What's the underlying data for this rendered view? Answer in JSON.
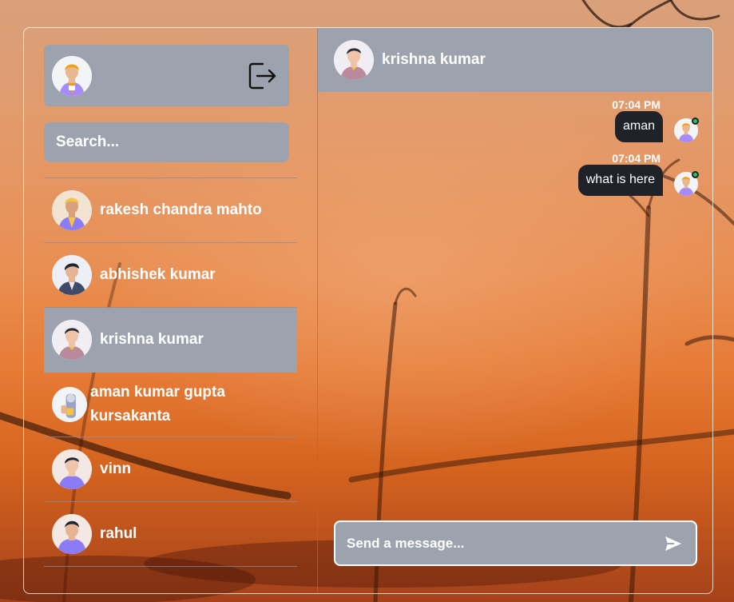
{
  "sidebar": {
    "current_user_avatar": "avatar-current-user",
    "logout_icon": "logout-icon",
    "search_placeholder": "Search...",
    "contacts": [
      {
        "name": "rakesh chandra mahto",
        "avatar": "avatar-yellow-hat",
        "active": false
      },
      {
        "name": "abhishek kumar",
        "avatar": "avatar-dark-jacket",
        "active": false
      },
      {
        "name": "krishna kumar",
        "avatar": "avatar-pink-shirt",
        "active": true
      },
      {
        "name": "aman kumar gupta\nkursakanta",
        "avatar": "avatar-mug-thumb",
        "active": false
      },
      {
        "name": "vinn",
        "avatar": "avatar-purple-shirt",
        "active": false
      },
      {
        "name": "rahul",
        "avatar": "avatar-purple-hoodie",
        "active": false
      }
    ]
  },
  "chat": {
    "header_name": "krishna kumar",
    "header_avatar": "avatar-pink-shirt",
    "messages": [
      {
        "time": "07:04 PM",
        "text": "aman",
        "sender": "self",
        "online": true
      },
      {
        "time": "07:04 PM",
        "text": "what is here",
        "sender": "self",
        "online": true
      }
    ],
    "composer_placeholder": "Send a message...",
    "send_icon": "send-icon"
  },
  "colors": {
    "panel": "#9ca3af",
    "bubble": "#1f2329",
    "online": "#22c55e",
    "text": "#ffffff"
  }
}
